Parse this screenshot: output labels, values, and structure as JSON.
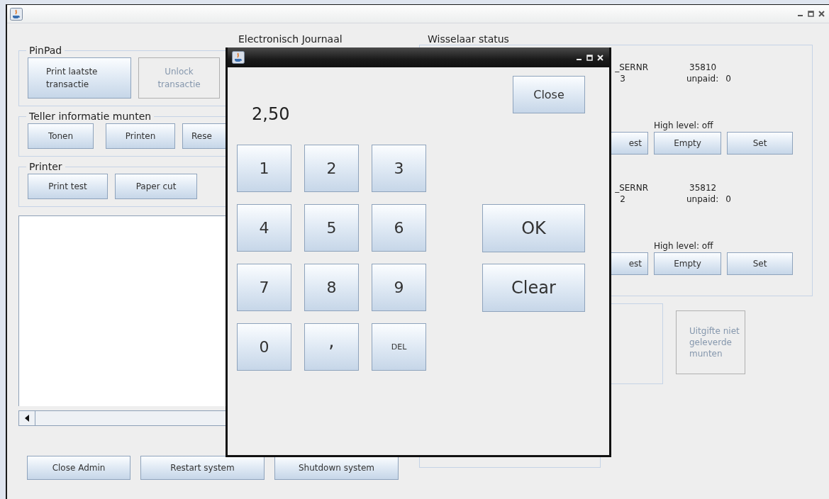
{
  "pinpad": {
    "title": "PinPad",
    "buttons": [
      {
        "label": "Print laatste transactie",
        "disabled": false
      },
      {
        "label": "Unlock transactie",
        "disabled": true
      }
    ]
  },
  "journal": {
    "title": "Electronisch Journaal"
  },
  "teller": {
    "title": "Teller informatie munten",
    "buttons": [
      "Tonen",
      "Printen",
      "Rese"
    ]
  },
  "printer": {
    "title": "Printer",
    "buttons": [
      "Print test",
      "Paper cut"
    ]
  },
  "bottom_buttons": [
    "Close Admin",
    "Restart system",
    "Shutdown system"
  ],
  "changer_status": {
    "title": "Wisselaar status",
    "changers": [
      {
        "serial_label": "_SERNR",
        "count": "3",
        "serial": "35810",
        "unpaid_label": "unpaid:",
        "unpaid": "0",
        "high_level": "High level: off",
        "buttons": [
          "est",
          "Empty",
          "Set"
        ]
      },
      {
        "serial_label": "_SERNR",
        "count": "2",
        "serial": "35812",
        "unpaid_label": "unpaid:",
        "unpaid": "0",
        "high_level": "High level: off",
        "buttons": [
          "est",
          "Empty",
          "Set"
        ]
      }
    ]
  },
  "undelivered_button": {
    "label": "Uitgifte niet geleverde munten",
    "disabled": true
  },
  "dialog": {
    "amount": "2,50",
    "close": "Close",
    "keys": [
      {
        "label": "1",
        "kind": "digit"
      },
      {
        "label": "2",
        "kind": "digit"
      },
      {
        "label": "3",
        "kind": "digit"
      },
      {
        "label": "4",
        "kind": "digit"
      },
      {
        "label": "5",
        "kind": "digit"
      },
      {
        "label": "6",
        "kind": "digit"
      },
      {
        "label": "7",
        "kind": "digit"
      },
      {
        "label": "8",
        "kind": "digit"
      },
      {
        "label": "9",
        "kind": "digit"
      },
      {
        "label": "0",
        "kind": "digit"
      },
      {
        "label": ",",
        "kind": "punct"
      },
      {
        "label": "DEL",
        "kind": "small"
      }
    ],
    "ok": "OK",
    "clear": "Clear"
  }
}
